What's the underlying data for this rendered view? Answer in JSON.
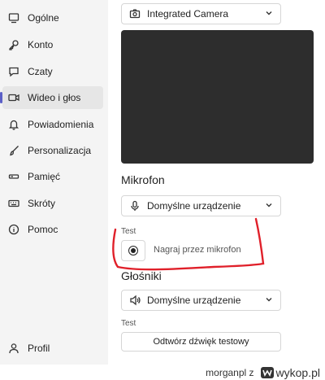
{
  "sidebar": {
    "items": [
      {
        "label": "Ogólne",
        "icon": "general-icon"
      },
      {
        "label": "Konto",
        "icon": "key-icon"
      },
      {
        "label": "Czaty",
        "icon": "chat-icon"
      },
      {
        "label": "Wideo i głos",
        "icon": "video-icon",
        "active": true
      },
      {
        "label": "Powiadomienia",
        "icon": "bell-icon"
      },
      {
        "label": "Personalizacja",
        "icon": "brush-icon"
      },
      {
        "label": "Pamięć",
        "icon": "storage-icon"
      },
      {
        "label": "Skróty",
        "icon": "keyboard-icon"
      },
      {
        "label": "Pomoc",
        "icon": "info-icon"
      }
    ],
    "profile_label": "Profil"
  },
  "camera": {
    "selected": "Integrated Camera"
  },
  "microphone": {
    "title": "Mikrofon",
    "selected": "Domyślne urządzenie",
    "test_label": "Test",
    "record_label": "Nagraj przez mikrofon"
  },
  "speakers": {
    "title": "Głośniki",
    "selected": "Domyślne urządzenie",
    "test_label": "Test",
    "test_button": "Odtwórz dźwięk testowy"
  },
  "annotation_color": "#e0202a",
  "accent_color": "#5b5fc7",
  "watermark": {
    "user": "morganpl",
    "separator": "z",
    "site": "wykop.pl"
  }
}
